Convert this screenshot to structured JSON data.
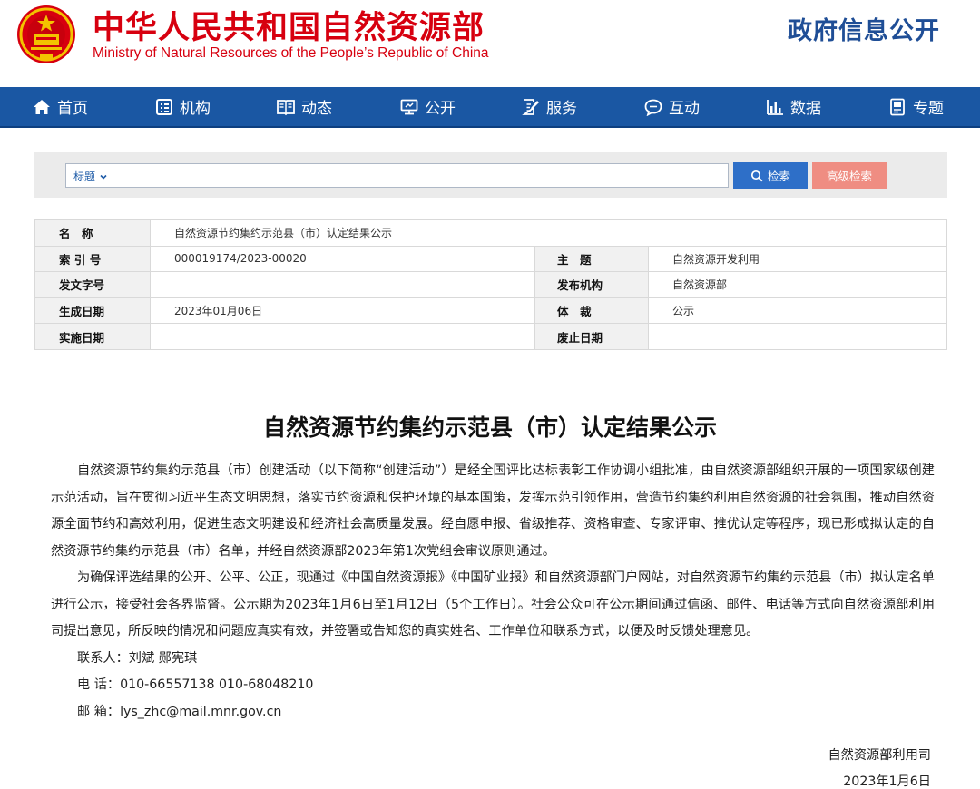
{
  "header": {
    "title_cn": "中华人民共和国自然资源部",
    "title_en": "Ministry of Natural Resources of the People’s Republic of China",
    "right_label": "政府信息公开",
    "brand_color": "#d7000f"
  },
  "nav": {
    "items": [
      {
        "label": "首页",
        "icon": "home-icon"
      },
      {
        "label": "机构",
        "icon": "organization-icon"
      },
      {
        "label": "动态",
        "icon": "news-book-icon"
      },
      {
        "label": "公开",
        "icon": "monitor-icon"
      },
      {
        "label": "服务",
        "icon": "edit-document-icon"
      },
      {
        "label": "互动",
        "icon": "chat-bubble-icon"
      },
      {
        "label": "数据",
        "icon": "bar-chart-icon"
      },
      {
        "label": "专题",
        "icon": "topic-document-icon"
      }
    ],
    "background": "#1a57a3"
  },
  "search": {
    "field_label": "标题",
    "input_value": "",
    "search_label": "检索",
    "advanced_label": "高级检索"
  },
  "meta": {
    "name_key": "名　称",
    "name_value": "自然资源节约集约示范县（市）认定结果公示",
    "index_key": "索 引 号",
    "index_value": "000019174/2023-00020",
    "subject_key": "主　题",
    "subject_value": "自然资源开发利用",
    "doc_no_key": "发文字号",
    "doc_no_value": "",
    "issuer_key": "发布机构",
    "issuer_value": "自然资源部",
    "date_key": "生成日期",
    "date_value": "2023年01月06日",
    "genre_key": "体　裁",
    "genre_value": "公示",
    "effective_key": "实施日期",
    "effective_value": "",
    "expiry_key": "废止日期",
    "expiry_value": ""
  },
  "article": {
    "title": "自然资源节约集约示范县（市）认定结果公示",
    "paragraph1": "自然资源节约集约示范县（市）创建活动（以下简称“创建活动”）是经全国评比达标表彰工作协调小组批准，由自然资源部组织开展的一项国家级创建示范活动，旨在贯彻习近平生态文明思想，落实节约资源和保护环境的基本国策，发挥示范引领作用，营造节约集约利用自然资源的社会氛围，推动自然资源全面节约和高效利用，促进生态文明建设和经济社会高质量发展。经自愿申报、省级推荐、资格审查、专家评审、推优认定等程序，现已形成拟认定的自然资源节约集约示范县（市）名单，并经自然资源部2023年第1次党组会审议原则通过。",
    "paragraph2": "为确保评选结果的公开、公平、公正，现通过《中国自然资源报》《中国矿业报》和自然资源部门户网站，对自然资源节约集约示范县（市）拟认定名单进行公示，接受社会各界监督。公示期为2023年1月6日至1月12日（5个工作日）。社会公众可在公示期间通过信函、邮件、电话等方式向自然资源部利用司提出意见，所反映的情况和问题应真实有效，并签署或告知您的真实姓名、工作单位和联系方式，以便及时反馈处理意见。",
    "contact_person": "联系人：刘斌  郧宪琪",
    "contact_phone": "电  话：010-66557138   010-68048210",
    "contact_email": "邮  箱：lys_zhc@mail.mnr.gov.cn",
    "signature_org": "自然资源部利用司",
    "signature_date": "2023年1月6日"
  }
}
